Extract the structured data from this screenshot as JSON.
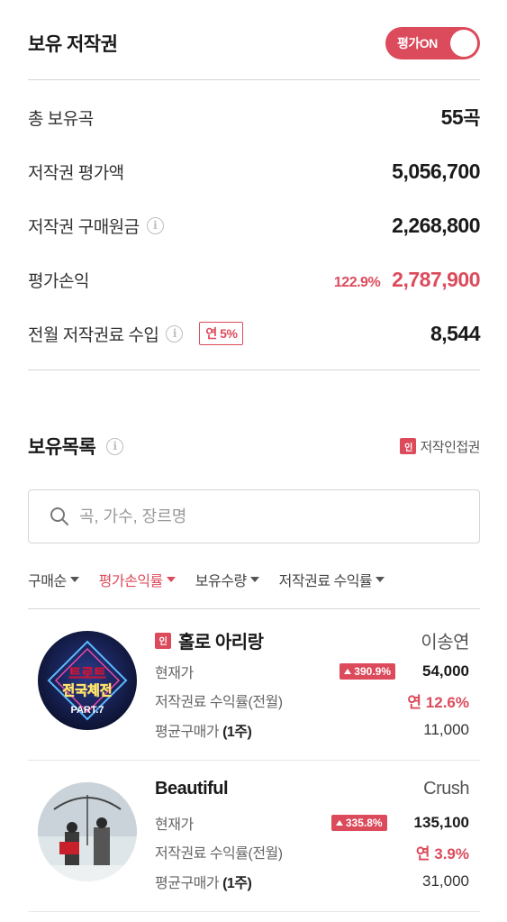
{
  "header": {
    "title": "보유 저작권",
    "toggle_label": "평가ON"
  },
  "summary": {
    "total_songs": {
      "label": "총 보유곡",
      "value": "55",
      "unit": "곡"
    },
    "valuation": {
      "label": "저작권 평가액",
      "value": "5,056,700"
    },
    "purchase_cost": {
      "label": "저작권 구매원금",
      "value": "2,268,800"
    },
    "pnl": {
      "label": "평가손익",
      "percent": "122.9%",
      "value": "2,787,900"
    },
    "royalty": {
      "label": "전월 저작권료 수입",
      "badge": "연 5%",
      "value": "8,544"
    }
  },
  "holdings": {
    "title": "보유목록",
    "legend_tag": "인",
    "legend_label": "저작인접권",
    "search_placeholder": "곡, 가수, 장르명",
    "sort_options": [
      "구매순",
      "평가손익률",
      "보유수량",
      "저작권료 수익률"
    ],
    "active_sort": "평가손익률",
    "labels": {
      "current_price": "현재가",
      "royalty_yield": "저작권료 수익률(전월)",
      "avg_price": "평균구매가",
      "avg_price_unit": "(1주)"
    },
    "items": [
      {
        "tag": "인",
        "title": "홀로 아리랑",
        "artist": "이송연",
        "change": "390.9%",
        "current_price": "54,000",
        "royalty_yield": "연 12.6%",
        "avg_price": "11,000",
        "cover_text_1": "트로트",
        "cover_text_2": "전국체전",
        "cover_text_3": "PART.7"
      },
      {
        "tag": "",
        "title": "Beautiful",
        "artist": "Crush",
        "change": "335.8%",
        "current_price": "135,100",
        "royalty_yield": "연 3.9%",
        "avg_price": "31,000"
      }
    ]
  },
  "colors": {
    "accent": "#dc4b5c",
    "divider": "#d6d6d6",
    "text": "#1a1a1a",
    "muted": "#666666"
  }
}
